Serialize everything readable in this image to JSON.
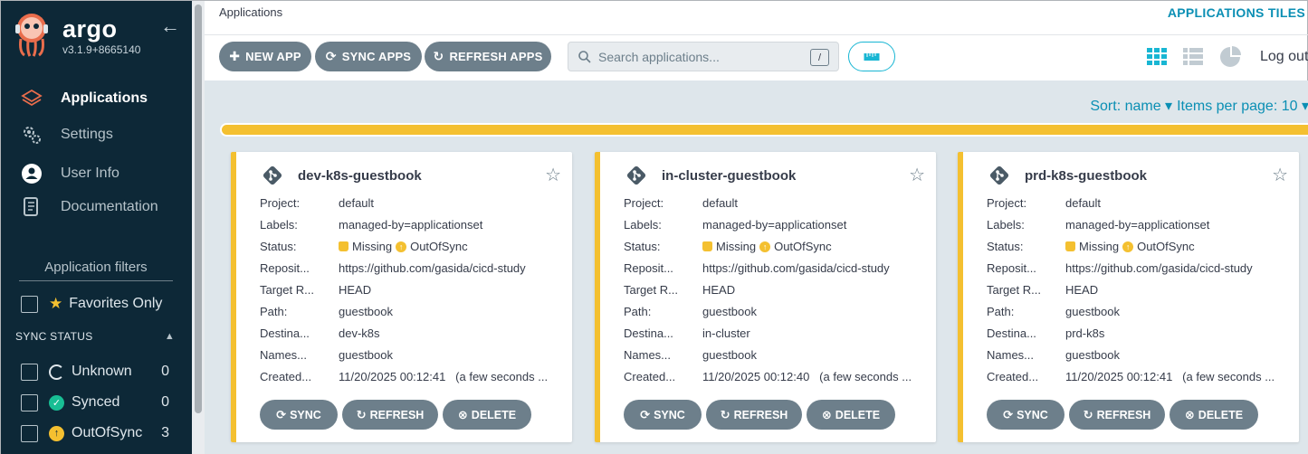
{
  "sidebar": {
    "brand": "argo",
    "version": "v3.1.9+8665140",
    "nav": [
      {
        "label": "Applications",
        "icon": "layers-icon",
        "active": true
      },
      {
        "label": "Settings",
        "icon": "gears-icon",
        "active": false
      },
      {
        "label": "User Info",
        "icon": "user-circle-icon",
        "active": false
      },
      {
        "label": "Documentation",
        "icon": "book-icon",
        "active": false
      }
    ],
    "filters_title": "Application filters",
    "favorites_label": "Favorites Only",
    "sync_status_title": "SYNC STATUS",
    "sync_filters": [
      {
        "label": "Unknown",
        "count": "0",
        "color": "#dee6eb"
      },
      {
        "label": "Synced",
        "count": "0",
        "color": "#18be94"
      },
      {
        "label": "OutOfSync",
        "count": "3",
        "color": "#f4c030"
      }
    ]
  },
  "header": {
    "breadcrumb": "Applications",
    "view_title": "APPLICATIONS TILES",
    "new_app": "NEW APP",
    "sync_apps": "SYNC APPS",
    "refresh_apps": "REFRESH APPS",
    "search_placeholder": "Search applications...",
    "search_shortcut": "/",
    "logout": "Log out"
  },
  "toolbar": {
    "sort": "Sort: name",
    "per_page": "Items per page: 10"
  },
  "colors": {
    "sidebar_bg": "#0d2837",
    "accent": "#0b8fb4",
    "warning": "#f4c030",
    "button": "#6d7f8b",
    "content_bg": "#dee6eb"
  },
  "card_labels": {
    "project": "Project:",
    "labels": "Labels:",
    "status": "Status:",
    "repository": "Reposit...",
    "target": "Target R...",
    "path": "Path:",
    "destination": "Destina...",
    "namespace": "Names...",
    "created": "Created..."
  },
  "card_actions": {
    "sync": "SYNC",
    "refresh": "REFRESH",
    "delete": "DELETE"
  },
  "apps": [
    {
      "name": "dev-k8s-guestbook",
      "project": "default",
      "labels": "managed-by=applicationset",
      "health": "Missing",
      "sync": "OutOfSync",
      "repository": "https://github.com/gasida/cicd-study",
      "target": "HEAD",
      "path": "guestbook",
      "destination": "dev-k8s",
      "namespace": "guestbook",
      "created": "11/20/2025 00:12:41",
      "created_rel": "(a few seconds ..."
    },
    {
      "name": "in-cluster-guestbook",
      "project": "default",
      "labels": "managed-by=applicationset",
      "health": "Missing",
      "sync": "OutOfSync",
      "repository": "https://github.com/gasida/cicd-study",
      "target": "HEAD",
      "path": "guestbook",
      "destination": "in-cluster",
      "namespace": "guestbook",
      "created": "11/20/2025 00:12:40",
      "created_rel": "(a few seconds ..."
    },
    {
      "name": "prd-k8s-guestbook",
      "project": "default",
      "labels": "managed-by=applicationset",
      "health": "Missing",
      "sync": "OutOfSync",
      "repository": "https://github.com/gasida/cicd-study",
      "target": "HEAD",
      "path": "guestbook",
      "destination": "prd-k8s",
      "namespace": "guestbook",
      "created": "11/20/2025 00:12:41",
      "created_rel": "(a few seconds ..."
    }
  ]
}
